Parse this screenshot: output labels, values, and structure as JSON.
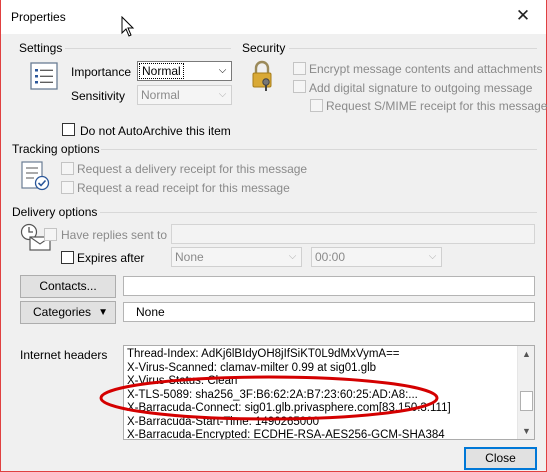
{
  "window": {
    "title": "Properties",
    "close_glyph": "✕"
  },
  "settings": {
    "title": "Settings",
    "importance": {
      "label": "Importance",
      "value": "Normal"
    },
    "sensitivity": {
      "label": "Sensitivity",
      "value": "Normal"
    },
    "do_not_autoarchive": "Do not AutoArchive this item"
  },
  "security": {
    "title": "Security",
    "encrypt": "Encrypt message contents and attachments",
    "digital_signature": "Add digital signature to outgoing message",
    "smime_receipt": "Request S/MIME receipt for this message"
  },
  "tracking": {
    "title": "Tracking options",
    "delivery_receipt": "Request a delivery receipt for this message",
    "read_receipt": "Request a read receipt for this message"
  },
  "delivery": {
    "title": "Delivery options",
    "have_replies": "Have replies sent to",
    "expires_after": "Expires after",
    "expires_date": "None",
    "expires_time": "00:00"
  },
  "contacts": {
    "button": "Contacts...",
    "value": ""
  },
  "categories": {
    "button": "Categories",
    "value": "None"
  },
  "internet_headers": {
    "label": "Internet headers",
    "lines": [
      "Thread-Index: AdKj6lBIdyOH8jIfSiKT0L9dMxVymA==",
      "X-Virus-Scanned: clamav-milter 0.99 at sig01.glb",
      "X-Virus-Status: Clean",
      "X-TLS-5089: sha256_3F:B6:62:2A:B7:23:60:25:AD:A8:...",
      "X-Barracuda-Connect: sig01.glb.privasphere.com[83.150.3.111]",
      "X-Barracuda-Start-Time: 1490265000",
      "X-Barracuda-Encrypted: ECDHE-RSA-AES256-GCM-SHA384"
    ]
  },
  "close_button": "Close",
  "colors": {
    "highlight_ellipse": "#d40000",
    "default_button_border": "#0078d7"
  }
}
